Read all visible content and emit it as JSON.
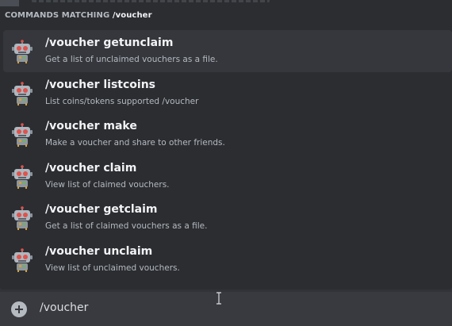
{
  "popup": {
    "header_prefix": "COMMANDS MATCHING",
    "header_query": "/voucher"
  },
  "commands": [
    {
      "name": "/voucher getunclaim",
      "description": "Get a list of unclaimed vouchers as a file.",
      "selected": true,
      "icon": "robot-icon"
    },
    {
      "name": "/voucher listcoins",
      "description": "List coins/tokens supported /voucher",
      "selected": false,
      "icon": "robot-icon"
    },
    {
      "name": "/voucher make",
      "description": "Make a voucher and share to other friends.",
      "selected": false,
      "icon": "robot-icon"
    },
    {
      "name": "/voucher claim",
      "description": "View list of claimed vouchers.",
      "selected": false,
      "icon": "robot-icon"
    },
    {
      "name": "/voucher getclaim",
      "description": "Get a list of claimed vouchers as a file.",
      "selected": false,
      "icon": "robot-icon"
    },
    {
      "name": "/voucher unclaim",
      "description": "View list of unclaimed vouchers.",
      "selected": false,
      "icon": "robot-icon"
    }
  ],
  "composer": {
    "value": "/voucher",
    "add_icon": "plus-circle-icon"
  },
  "colors": {
    "popup_bg": "#2b2d31",
    "selected_bg": "#35373c",
    "composer_bg": "#383a40",
    "accent_robot": "#d4a03a"
  }
}
